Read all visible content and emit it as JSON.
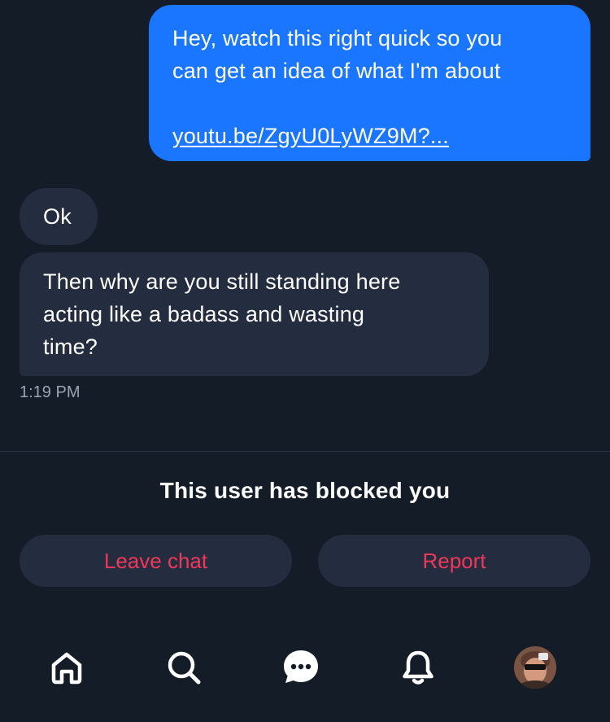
{
  "messages": [
    {
      "direction": "outgoing",
      "lines": [
        "Hey, watch this right quick so you",
        "can get an idea of what I'm about"
      ],
      "link": "youtu.be/ZgyU0LyWZ9M?..."
    },
    {
      "direction": "incoming",
      "text": "Ok"
    },
    {
      "direction": "incoming",
      "lines": [
        "Then why are you still standing here",
        "acting like a badass and wasting",
        "time?"
      ]
    }
  ],
  "timestamp": "1:19 PM",
  "blocked_notice": "This user has blocked you",
  "actions": {
    "leave_label": "Leave chat",
    "report_label": "Report"
  },
  "tabbar": {
    "items": [
      {
        "name": "home",
        "icon": "home-icon"
      },
      {
        "name": "search",
        "icon": "search-icon"
      },
      {
        "name": "messages",
        "icon": "chat-bubble-icon"
      },
      {
        "name": "notifications",
        "icon": "bell-icon"
      },
      {
        "name": "profile",
        "icon": "avatar"
      }
    ]
  },
  "colors": {
    "background": "#141c28",
    "outgoing_bubble": "#1a75ff",
    "incoming_bubble": "#232d3f",
    "danger_text": "#f0375a",
    "muted_text": "#9aa3b2"
  }
}
